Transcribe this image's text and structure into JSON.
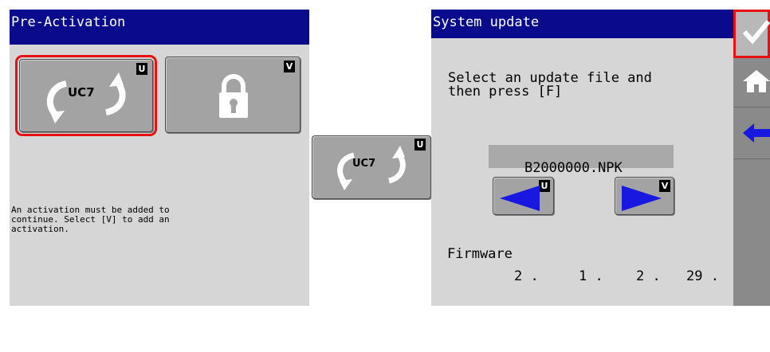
{
  "left_panel": {
    "title": "Pre-Activation",
    "uc7_button": {
      "label": "UC7",
      "tag": "U"
    },
    "lock_button": {
      "tag": "V"
    },
    "message": "An activation must be added to\ncontinue. Select [V] to add an\nactivation."
  },
  "middle": {
    "uc7_button": {
      "label": "UC7",
      "tag": "U"
    }
  },
  "right_panel": {
    "title": "System update",
    "instruction": "Select an update file and\nthen press [F]",
    "file_name": "B2000000.NPK",
    "prev_button_tag": "U",
    "next_button_tag": "V",
    "firmware_label": "Firmware",
    "firmware_version": [
      "2 .",
      "1 .",
      "2 .",
      "29 ."
    ]
  },
  "sidebar": {
    "icons": [
      "checkmark-icon",
      "home-icon",
      "back-arrow-icon"
    ]
  },
  "colors": {
    "title_bar": "#0a0a8c",
    "panel_bg": "#d6d6d6",
    "button_bg": "#a3a3a3",
    "selection": "#e81010",
    "arrow_blue": "#1818e0",
    "sidebar": "#8a8a8a"
  }
}
